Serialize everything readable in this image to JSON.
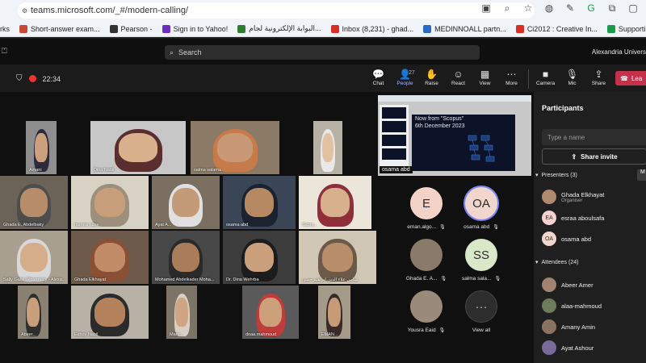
{
  "browser": {
    "url": "teams.microsoft.com/_#/modern-calling/",
    "bookmarks": [
      "rks",
      "Short-answer exam...",
      "Pearson -",
      "Sign in to Yahoo!",
      "البوابة الإلكترونية لجام...",
      "Inbox (8,231) - ghad...",
      "MEDINNOALL partn...",
      "Ci2012 : Creative In...",
      "Supporting future-o..."
    ]
  },
  "teams": {
    "search_placeholder": "Search",
    "org_name": "Alexandria Univers"
  },
  "meeting": {
    "elapsed": "22:34",
    "toolbar": [
      {
        "label": "Chat",
        "icon": "chat-icon",
        "glyph": "💬"
      },
      {
        "label": "People",
        "icon": "people-icon",
        "glyph": "👤",
        "count": "27"
      },
      {
        "label": "Raise",
        "icon": "raise-hand-icon",
        "glyph": "✋"
      },
      {
        "label": "React",
        "icon": "react-icon",
        "glyph": "☺"
      },
      {
        "label": "View",
        "icon": "view-icon",
        "glyph": "▦"
      },
      {
        "label": "More",
        "icon": "more-icon",
        "glyph": "⋯"
      },
      {
        "label": "Camera",
        "icon": "camera-icon",
        "glyph": "■"
      },
      {
        "label": "Mic",
        "icon": "mic-off-icon",
        "glyph": "🎙"
      },
      {
        "label": "Share",
        "icon": "share-icon",
        "glyph": "⇪"
      }
    ],
    "leave_label": "Lea"
  },
  "video_tiles": [
    {
      "name": "Amani",
      "bg": "#8e8e8e",
      "skin": "#caa07d",
      "scarf": "#2b2b3d"
    },
    {
      "name": "Dina Nabil",
      "bg": "#c7c7c7",
      "skin": "#d9b18d",
      "scarf": "#5a2e2e"
    },
    {
      "name": "salma salama",
      "bg": "#8a7a66",
      "skin": "#c99877",
      "scarf": "#c77b4a"
    },
    {
      "name": "",
      "bg": "#b7b0a4",
      "skin": "#e2c1a2",
      "scarf": "#e8e8e8"
    },
    {
      "name": "Ghada E. Abdelbaky",
      "bg": "#6b6358",
      "skin": "#b78c6a",
      "scarf": "#4d4d4d"
    },
    {
      "name": "manea rabie",
      "bg": "#d8d2c5",
      "skin": "#c79e7a",
      "scarf": "#9c8f7c"
    },
    {
      "name": "Ayat A...",
      "bg": "#7a6f60",
      "skin": "#c49b78",
      "scarf": "#e0e0e0"
    },
    {
      "name": "osama abd",
      "bg": "#3a4655",
      "skin": "#b78963",
      "scarf": "#1b2230"
    },
    {
      "name": "Sabry...",
      "bg": "#ece6da",
      "skin": "#d7b08d",
      "scarf": "#8f2f3c"
    },
    {
      "name": "Sally Galal (Pharmacy - Alexa...",
      "bg": "#a89f8e",
      "skin": "#d6ad8a",
      "scarf": "#d8d8d8"
    },
    {
      "name": "Ghada Elkhayat",
      "bg": "#6d5a4a",
      "skin": "#c28c68",
      "scarf": "#8a4f35"
    },
    {
      "name": "Mohamed Abdelkader Moha...",
      "bg": "#474747",
      "skin": "#a97c5a",
      "scarf": "#2a2a2a"
    },
    {
      "name": "Dr. Dina Wehrba",
      "bg": "#3c3c3c",
      "skin": "#c99f7c",
      "scarf": "#1c1c1c"
    },
    {
      "name": "سامي علاء الدين ابراهيم حسن",
      "bg": "#cfc6b4",
      "skin": "#b78d6a",
      "scarf": "#6b5a47"
    },
    {
      "name": "Abeer...",
      "bg": "#8a8172",
      "skin": "#c89e7b",
      "scarf": "#2f2f2f"
    },
    {
      "name": "Eshoy Nabil",
      "bg": "#b8b1a5",
      "skin": "#b4825d",
      "scarf": "#2b2b2b"
    },
    {
      "name": "Mani...",
      "bg": "#7d7468",
      "skin": "#cfa583",
      "scarf": "#d7d0c4"
    },
    {
      "name": "doaa.mahmoud",
      "bg": "#5a5a5a",
      "skin": "#cd9f7b",
      "scarf": "#c23b3b"
    },
    {
      "name": "EMAN...",
      "bg": "#a49a8a",
      "skin": "#c79b78",
      "scarf": "#3a2a2a"
    }
  ],
  "shared_screen": {
    "title": "Now from \"Scopus\"",
    "date": "6th December 2023",
    "presenter": "osama abd"
  },
  "avatar_tiles": [
    {
      "initials": "E",
      "name": "eman.algo...",
      "color": "#f3d2c7"
    },
    {
      "initials": "OA",
      "name": "osama abd",
      "color": "#f0d6cc"
    },
    {
      "initials": "",
      "name": "Ghada E. A...",
      "color": "#8a7a6a"
    },
    {
      "initials": "SS",
      "name": "salma sala...",
      "color": "#d9e8c8"
    },
    {
      "initials": "",
      "name": "Yousra Eaid",
      "color": "#9a8a7a"
    },
    {
      "initials": "···",
      "name": "View all",
      "color": "#2d2d2d"
    }
  ],
  "participants": {
    "title": "Participants",
    "search_placeholder": "Type a name",
    "share_invite": "Share invite",
    "mute_label": "M",
    "presenters_label": "Presenters (3)",
    "attendees_label": "Attendees (24)",
    "presenters": [
      {
        "name": "Ghada Elkhayat",
        "role": "Organiser",
        "initials": "",
        "color": "#b08a70"
      },
      {
        "name": "esraa aboulsafa",
        "role": "",
        "initials": "EA",
        "color": "#f3d2cf"
      },
      {
        "name": "osama abd",
        "role": "",
        "initials": "OA",
        "color": "#f0d6cc"
      }
    ],
    "attendees": [
      {
        "name": "Abeer Amer",
        "initials": "",
        "color": "#a08470"
      },
      {
        "name": "alaa-mahmoud",
        "initials": "",
        "color": "#6d7b5a"
      },
      {
        "name": "Amany Amin",
        "initials": "",
        "color": "#8b7362"
      },
      {
        "name": "Ayat Ashour",
        "initials": "",
        "color": "#7a6a9a"
      }
    ]
  }
}
